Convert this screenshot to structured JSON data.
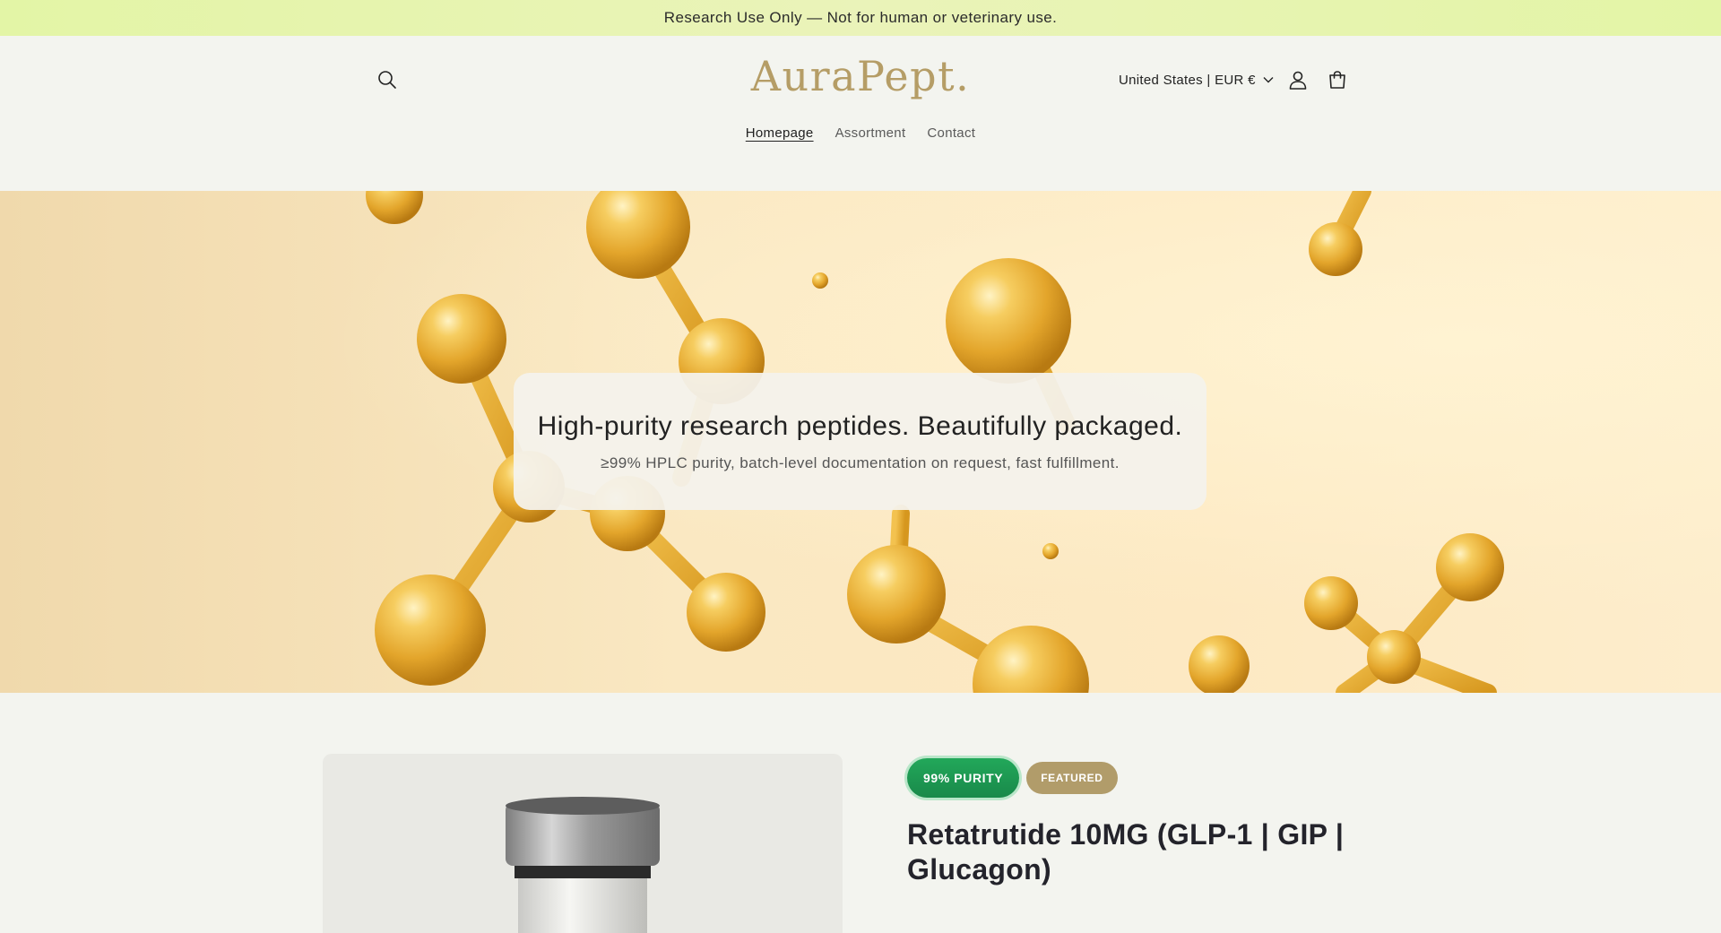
{
  "announcement": {
    "text": "Research Use Only — Not for human or veterinary use."
  },
  "header": {
    "logo": "AuraPept.",
    "country_selector": "United States | EUR €",
    "icons": {
      "search": "search-icon",
      "account": "account-icon",
      "cart": "cart-icon",
      "chevron": "chevron-down-icon"
    }
  },
  "nav": {
    "items": [
      {
        "label": "Homepage",
        "active": true
      },
      {
        "label": "Assortment",
        "active": false
      },
      {
        "label": "Contact",
        "active": false
      }
    ]
  },
  "hero": {
    "title": "High-purity research peptides. Beautifully packaged.",
    "subtitle": "≥99% HPLC purity, batch-level documentation on request, fast fulfillment."
  },
  "product": {
    "badges": {
      "purity": "99% PURITY",
      "featured": "FEATURED"
    },
    "title": "Retatrutide 10MG (GLP-1 | GIP | Glucagon)"
  },
  "colors": {
    "announcement_bg": "#e3f5a6",
    "logo": "#b59d66",
    "purity_badge": "#1f9e55",
    "featured_badge": "#b19c6a",
    "page_bg": "#f3f4ef"
  }
}
